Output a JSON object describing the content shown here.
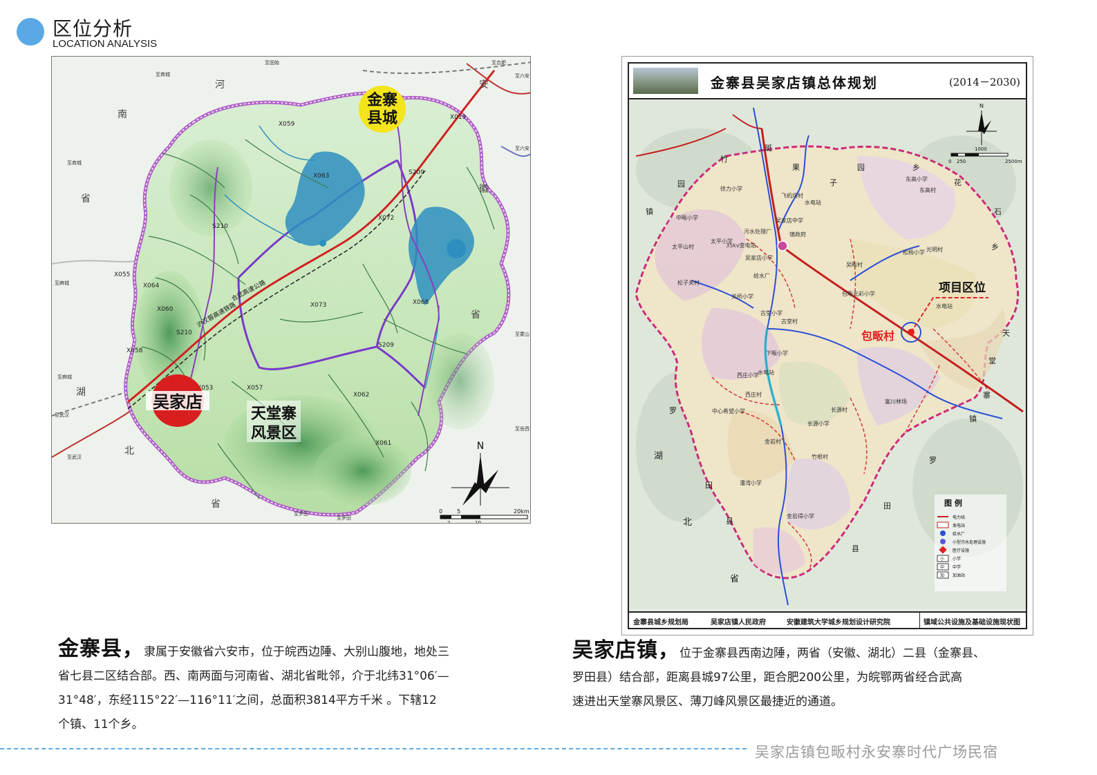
{
  "header": {
    "title": "区位分析",
    "subtitle": "LOCATION ANALYSIS"
  },
  "left_map": {
    "county_seat_label_1": "金寨",
    "county_seat_label_2": "县城",
    "wujiadian_label": "吴家店",
    "scenic_label_1": "天堂寨",
    "scenic_label_2": "风景区",
    "north_label": "N",
    "scale_ticks": [
      "0",
      "5",
      "20km"
    ],
    "scale_sub_ticks": [
      "2",
      "10"
    ],
    "province_labels": {
      "henan": [
        "河",
        "南",
        "省"
      ],
      "hubei": [
        "湖",
        "北",
        "省"
      ],
      "anhui": [
        "安",
        "徽",
        "省"
      ]
    },
    "road_labels": [
      "S210",
      "S209",
      "X059",
      "X063",
      "X072",
      "X064",
      "X060",
      "X058",
      "X053",
      "X057",
      "X062",
      "X061",
      "X068",
      "X073",
      "X055",
      "X019",
      "S210",
      "S209"
    ],
    "expressway_labels": [
      "合武高速公路",
      "沪汉蓉高速铁路"
    ],
    "edge_labels": [
      "至固始",
      "至合肥",
      "至六安",
      "至商城",
      "至商城",
      "至麻城",
      "至麻城",
      "至武汉",
      "至武汉",
      "至罗田",
      "至罗田",
      "至霍山",
      "至岳西",
      "至六安"
    ],
    "colors": {
      "county_seat_badge": "#f4e41c",
      "wujiadian_badge": "#d81e1e",
      "boundary": "#b060c8",
      "water": "#2e8fbf"
    }
  },
  "right_map": {
    "title": "金寨县吴家店镇总体规划",
    "years": "(2014－2030)",
    "project_label": "项目区位",
    "village_label": "包畈村",
    "north_label": "N",
    "scale_ticks": [
      "0",
      "250",
      "1000",
      "2500m"
    ],
    "legend_title": "图 例",
    "legend_items": [
      "电力线",
      "发电站",
      "给水厂",
      "小型污水处理设施",
      "医疗设施",
      "小学",
      "中学",
      "加油站"
    ],
    "legend_symbols": [
      "",
      "",
      "",
      "",
      "",
      "小",
      "中",
      "加"
    ],
    "neighbor_labels": [
      "斑",
      "竹",
      "园",
      "果",
      "子",
      "园",
      "乡",
      "花",
      "石",
      "乡",
      "天",
      "堂",
      "寨",
      "镇",
      "罗",
      "田",
      "县",
      "湖",
      "北",
      "省",
      "罗",
      "田",
      "县",
      "镇"
    ],
    "place_labels": [
      "东高小学",
      "东高村",
      "古堂小学",
      "古堂村",
      "下畈小学",
      "西庄小学",
      "西庄村",
      "中心希望小学",
      "长源小学",
      "长源村",
      "竹根村",
      "潘湾小学",
      "金岩村",
      "金岩得小学",
      "松子关村",
      "关桥小学",
      "太平山村",
      "太平小学",
      "中畈小学",
      "吴家店中学",
      "镇政府",
      "吴家店小学",
      "污水处理厂",
      "35kv变电站",
      "给水厂",
      "水电站",
      "水电站",
      "水电站",
      "吴畈村",
      "包畈光彩小学",
      "松杨小学",
      "光明村",
      "富川林场",
      "徐力小学",
      "飞机场村"
    ],
    "footer": {
      "org1": "金寨县城乡规划局",
      "org2": "吴家店镇人民政府",
      "org3": "安徽建筑大学城乡规划设计研究院",
      "map_name": "镇域公共设施及基础设施现状图"
    },
    "colors": {
      "project_marker": "#e02020",
      "powerline": "#c42020",
      "river": "#2a4fd6"
    }
  },
  "paragraphs": {
    "left": {
      "lead": "金寨县，",
      "line1": "隶属于安徽省六安市，位于皖西边陲、大别山腹地，地处三",
      "line2": "省七县二区结合部。西、南两面与河南省、湖北省毗邻，介于北纬31°06′—",
      "line3": "31°48′，东经115°22′—116°11′之间，总面积3814平方千米 。下辖12",
      "line4": "个镇、11个乡。"
    },
    "right": {
      "lead": "吴家店镇，",
      "line1": "位于金寨县西南边陲，两省（安徽、湖北）二县（金寨县、",
      "line2": "罗田县）结合部，距离县城97公里，距合肥200公里，为皖鄂两省经合武高",
      "line3": "速进出天堂寨风景区、薄刀峰风景区最捷近的通道。"
    }
  },
  "footer": {
    "brand": "吴家店镇包畈村永安寨时代广场民宿"
  }
}
